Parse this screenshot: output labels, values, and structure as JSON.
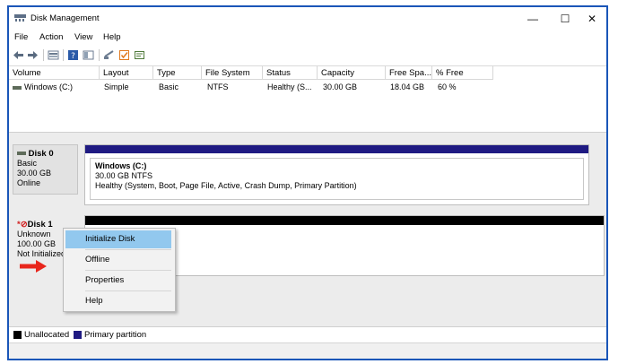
{
  "window": {
    "title": "Disk Management",
    "controls": {
      "minimize": "—",
      "maximize": "☐",
      "close": "✕"
    }
  },
  "menu": [
    "File",
    "Action",
    "View",
    "Help"
  ],
  "toolbar": {
    "icons": [
      "back-icon",
      "forward-icon",
      "disk-list-icon",
      "help-icon",
      "show-hide-icon",
      "rescan-icon",
      "check-icon",
      "properties-icon"
    ]
  },
  "volume_table": {
    "headers": [
      "Volume",
      "Layout",
      "Type",
      "File System",
      "Status",
      "Capacity",
      "Free Spa...",
      "% Free"
    ],
    "rows": [
      {
        "volume": "Windows (C:)",
        "layout": "Simple",
        "type": "Basic",
        "fs": "NTFS",
        "status": "Healthy (S...",
        "capacity": "30.00 GB",
        "free": "18.04 GB",
        "pct": "60 %"
      }
    ]
  },
  "disks": [
    {
      "name": "Disk 0",
      "type": "Basic",
      "size": "30.00 GB",
      "state": "Online",
      "partition": {
        "title": "Windows  (C:)",
        "size_fs": "30.00 GB NTFS",
        "health": "Healthy (System, Boot, Page File, Active, Crash Dump, Primary Partition)"
      }
    },
    {
      "name": "Disk 1",
      "type": "Unknown",
      "size": "100.00 GB",
      "state": "Not Initialized"
    }
  ],
  "context_menu": [
    "Initialize Disk",
    "Offline",
    "Properties",
    "Help"
  ],
  "legend": [
    {
      "label": "Unallocated",
      "color": "#000000"
    },
    {
      "label": "Primary partition",
      "color": "#1f1a82"
    }
  ],
  "colors": {
    "accent": "#1a56b8",
    "primary_partition": "#1f1a82",
    "unallocated": "#000000",
    "highlight": "#92c8ee",
    "arrow": "#e8261c"
  }
}
